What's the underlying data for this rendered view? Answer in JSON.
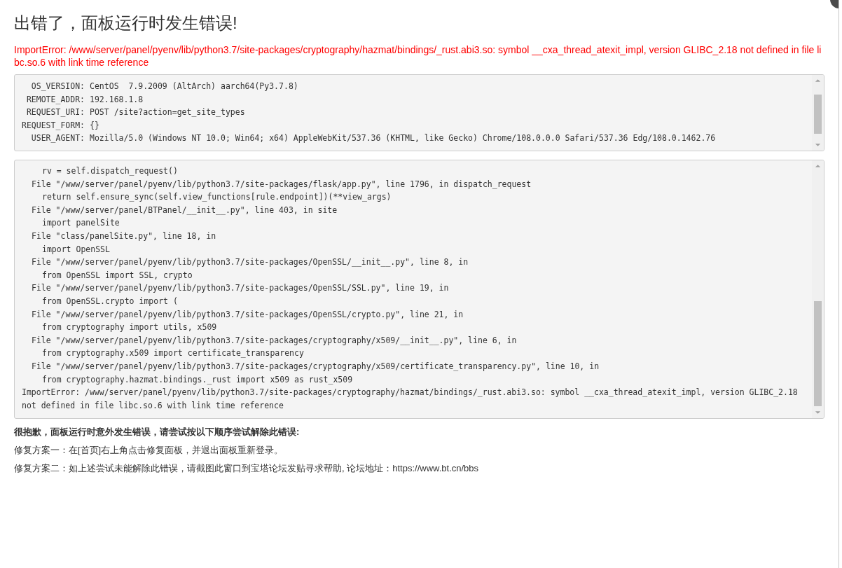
{
  "title": "出错了，面板运行时发生错误!",
  "error_message": "ImportError: /www/server/panel/pyenv/lib/python3.7/site-packages/cryptography/hazmat/bindings/_rust.abi3.so: symbol __cxa_thread_atexit_impl, version GLIBC_2.18 not defined in file libc.so.6 with link time reference",
  "environment": [
    {
      "key": "OS_VERSION:",
      "value": "CentOS  7.9.2009 (AltArch) aarch64(Py3.7.8)"
    },
    {
      "key": "REMOTE_ADDR:",
      "value": "192.168.1.8"
    },
    {
      "key": "REQUEST_URI:",
      "value": "POST /site?action=get_site_types"
    },
    {
      "key": "REQUEST_FORM:",
      "value": "{}"
    },
    {
      "key": "USER_AGENT:",
      "value": "Mozilla/5.0 (Windows NT 10.0; Win64; x64) AppleWebKit/537.36 (KHTML, like Gecko) Chrome/108.0.0.0 Safari/537.36 Edg/108.0.1462.76"
    }
  ],
  "traceback": [
    {
      "kind": "code",
      "text": "rv = self.dispatch_request()"
    },
    {
      "kind": "file",
      "text": "File \"/www/server/panel/pyenv/lib/python3.7/site-packages/flask/app.py\", line 1796, in dispatch_request"
    },
    {
      "kind": "code",
      "text": "return self.ensure_sync(self.view_functions[rule.endpoint])(**view_args)"
    },
    {
      "kind": "file",
      "text": "File \"/www/server/panel/BTPanel/__init__.py\", line 403, in site"
    },
    {
      "kind": "code",
      "text": "import panelSite"
    },
    {
      "kind": "file",
      "text": "File \"class/panelSite.py\", line 18, in"
    },
    {
      "kind": "code",
      "text": "import OpenSSL"
    },
    {
      "kind": "file",
      "text": "File \"/www/server/panel/pyenv/lib/python3.7/site-packages/OpenSSL/__init__.py\", line 8, in"
    },
    {
      "kind": "code",
      "text": "from OpenSSL import SSL, crypto"
    },
    {
      "kind": "file",
      "text": "File \"/www/server/panel/pyenv/lib/python3.7/site-packages/OpenSSL/SSL.py\", line 19, in"
    },
    {
      "kind": "code",
      "text": "from OpenSSL.crypto import ("
    },
    {
      "kind": "file",
      "text": "File \"/www/server/panel/pyenv/lib/python3.7/site-packages/OpenSSL/crypto.py\", line 21, in"
    },
    {
      "kind": "code",
      "text": "from cryptography import utils, x509"
    },
    {
      "kind": "file",
      "text": "File \"/www/server/panel/pyenv/lib/python3.7/site-packages/cryptography/x509/__init__.py\", line 6, in"
    },
    {
      "kind": "code",
      "text": "from cryptography.x509 import certificate_transparency"
    },
    {
      "kind": "file",
      "text": "File \"/www/server/panel/pyenv/lib/python3.7/site-packages/cryptography/x509/certificate_transparency.py\", line 10, in"
    },
    {
      "kind": "code",
      "text": "from cryptography.hazmat.bindings._rust import x509 as rust_x509"
    },
    {
      "kind": "error",
      "text": "ImportError: /www/server/panel/pyenv/lib/python3.7/site-packages/cryptography/hazmat/bindings/_rust.abi3.so: symbol __cxa_thread_atexit_impl, version GLIBC_2.18 not defined in file libc.so.6 with link time reference"
    }
  ],
  "help": {
    "heading": "很抱歉，面板运行时意外发生错误，请尝试按以下顺序尝试解除此错误:",
    "steps": [
      "修复方案一：在[首页]右上角点击修复面板，并退出面板重新登录。",
      "修复方案二：如上述尝试未能解除此错误，请截图此窗口到宝塔论坛发贴寻求帮助, 论坛地址：https://www.bt.cn/bbs"
    ]
  }
}
